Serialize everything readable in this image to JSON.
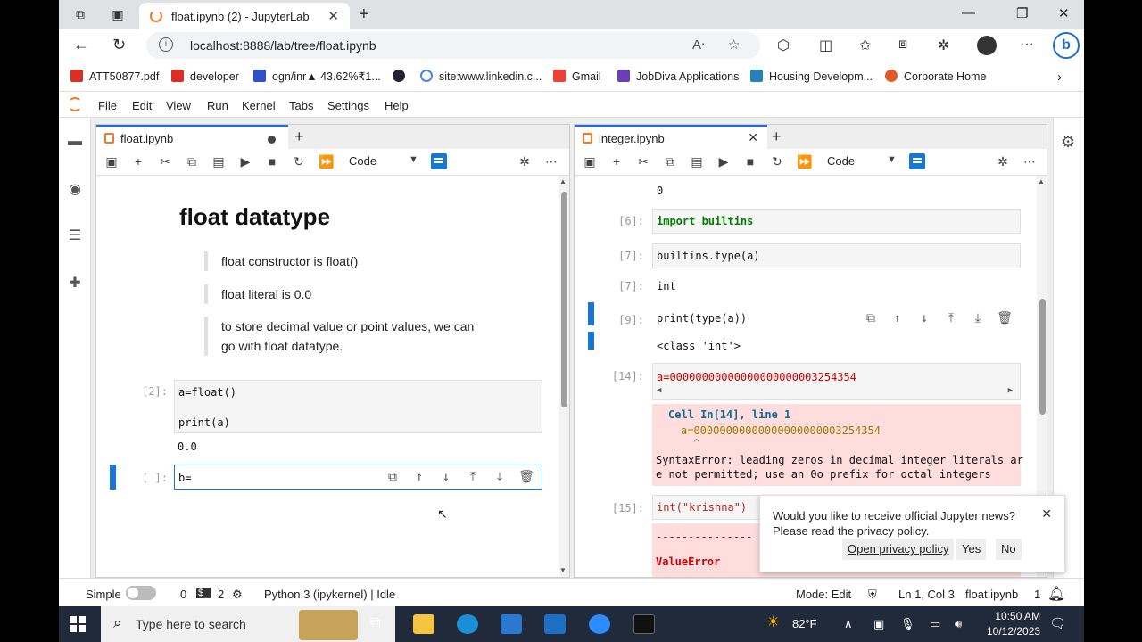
{
  "browser": {
    "tab_title": "float.ipynb (2) - JupyterLab",
    "url": "localhost:8888/lab/tree/float.ipynb",
    "bookmarks": [
      "ATT50877.pdf",
      "developer",
      "ogn/inr▲ 43.62%₹1...",
      "site:www.linkedin.c...",
      "Gmail",
      "JobDiva Applications",
      "Housing Developm...",
      "Corporate Home"
    ]
  },
  "jupyter": {
    "menu": [
      "File",
      "Edit",
      "View",
      "Run",
      "Kernel",
      "Tabs",
      "Settings",
      "Help"
    ],
    "left_panel": {
      "tab": "float.ipynb",
      "cell_type": "Code",
      "heading": "float datatype",
      "quotes": [
        "float constructor is float()",
        "float literal is 0.0",
        "to store decimal value or point values, we can go with float datatype."
      ],
      "cell2_prompt": "[2]:",
      "cell2_line1": "a=float()",
      "cell2_line2": "print(a)",
      "cell2_output": "0.0",
      "cell3_prompt": "[ ]:",
      "cell3_code": "b="
    },
    "right_panel": {
      "tab": "integer.ipynb",
      "cell_type": "Code",
      "top_output": "0",
      "c6_prompt": "[6]:",
      "c6_code": "import builtins",
      "c7_prompt": "[7]:",
      "c7_code": "builtins.type(a)",
      "c7_out_prompt": "[7]:",
      "c7_out": "int",
      "c9_prompt": "[9]:",
      "c9_code": "print(type(a))",
      "c9_out": "<class 'int'>",
      "c14_prompt": "[14]:",
      "c14_code": "a=00000000000000000000003254354",
      "c14_err": [
        "Cell In[14], line 1",
        "a=00000000000000000000003254354",
        "^",
        "SyntaxError: leading zeros in decimal integer literals ar",
        "e not permitted; use an 0o prefix for octal integers"
      ],
      "c15_prompt": "[15]:",
      "c15_code": "int(\"krishna\")",
      "c15_err_dashes": "---------------",
      "c15_err_name": "ValueError"
    },
    "toast": {
      "message": "Would you like to receive official Jupyter news? Please read the privacy policy.",
      "link": "Open privacy policy",
      "yes": "Yes",
      "no": "No"
    },
    "status": {
      "simple": "Simple",
      "zero": "0",
      "terminals": "2",
      "kernel": "Python 3 (ipykernel) | Idle",
      "mode": "Mode: Edit",
      "pos": "Ln 1, Col 3",
      "file": "float.ipynb",
      "count": "1"
    }
  },
  "taskbar": {
    "search_placeholder": "Type here to search",
    "temp": "82°F",
    "time": "10:50 AM",
    "date": "10/12/2023"
  },
  "colors": {
    "accent": "#1976d2",
    "jupyter_orange": "#f37726",
    "error_bg": "#ffdddd"
  }
}
